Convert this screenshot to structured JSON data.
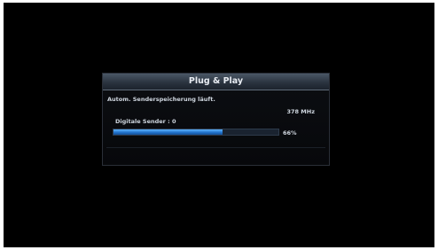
{
  "dialog": {
    "title": "Plug & Play",
    "status": "Autom. Senderspeicherung läuft.",
    "frequency": "378 MHz",
    "channels": "Digitale Sender : 0",
    "progress_percent": 66,
    "progress_label": "66%"
  },
  "colors": {
    "background": "#000000",
    "progress_fill": "#2a8ae8",
    "title_bar": "#2b3440"
  }
}
